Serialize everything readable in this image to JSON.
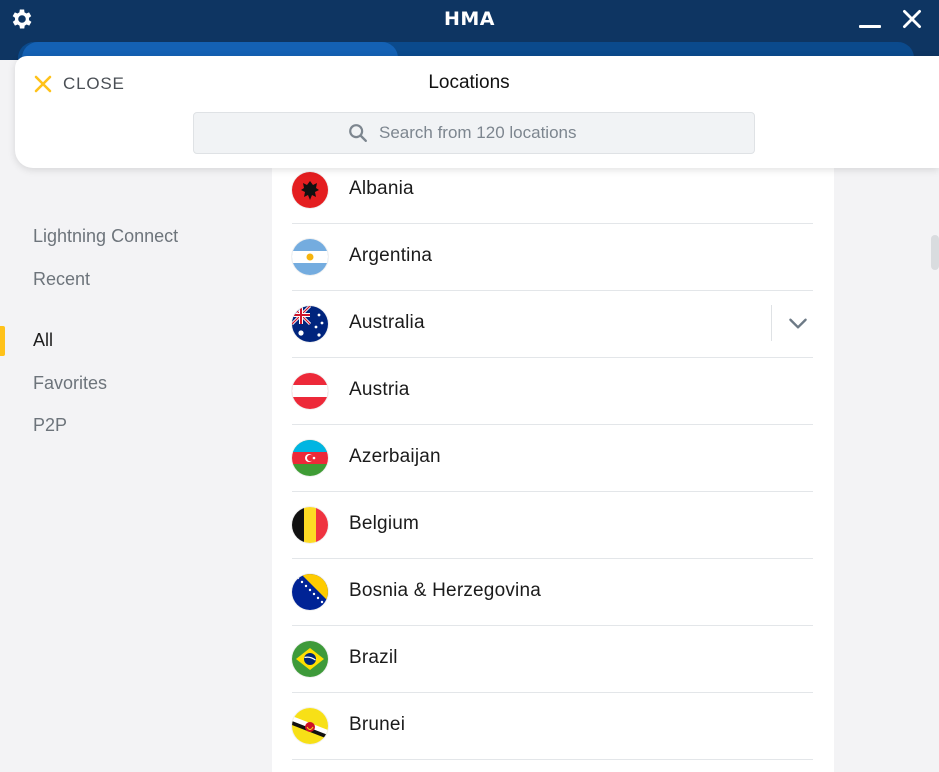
{
  "app": {
    "title": "HMA",
    "icons": {
      "settings": "gear-icon",
      "minimize": "minimize-icon",
      "close": "close-window-icon"
    },
    "colors": {
      "titlebar": "#0e3562",
      "accent": "#ffc21a",
      "tab_active": "#1461b4"
    }
  },
  "header": {
    "close_label": "CLOSE",
    "title": "Locations",
    "search": {
      "placeholder": "Search from 120 locations",
      "value": ""
    }
  },
  "sidebar": {
    "items": [
      {
        "label": "Lightning Connect",
        "active": false
      },
      {
        "label": "Recent",
        "active": false
      },
      {
        "label": "All",
        "active": true
      },
      {
        "label": "Favorites",
        "active": false
      },
      {
        "label": "P2P",
        "active": false
      }
    ]
  },
  "locations": [
    {
      "name": "Albania",
      "flag": "albania-flag-icon"
    },
    {
      "name": "Argentina",
      "flag": "argentina-flag-icon"
    },
    {
      "name": "Australia",
      "flag": "australia-flag-icon",
      "expandable": true
    },
    {
      "name": "Austria",
      "flag": "austria-flag-icon"
    },
    {
      "name": "Azerbaijan",
      "flag": "azerbaijan-flag-icon"
    },
    {
      "name": "Belgium",
      "flag": "belgium-flag-icon"
    },
    {
      "name": "Bosnia & Herzegovina",
      "flag": "bosnia-flag-icon"
    },
    {
      "name": "Brazil",
      "flag": "brazil-flag-icon"
    },
    {
      "name": "Brunei",
      "flag": "brunei-flag-icon"
    }
  ]
}
